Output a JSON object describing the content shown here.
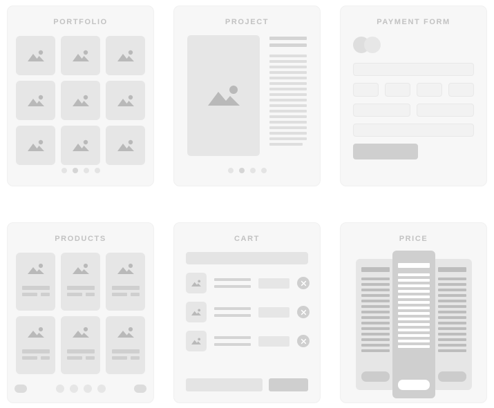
{
  "page": {
    "background_color": "#ffffff",
    "card_background": "#f7f7f7",
    "title_color": "#c2c2c2",
    "placeholder_light": "#e6e6e6",
    "placeholder_mid": "#dedede",
    "placeholder_dark": "#cfcfcf",
    "accent_white": "#ffffff"
  },
  "cards": [
    {
      "id": "portfolio",
      "title": "PORTFOLIO",
      "layout": "image-grid",
      "tiles": 9,
      "tile_icon": "image-placeholder-icon",
      "pagination": {
        "dots": 4,
        "active_index": 1
      }
    },
    {
      "id": "project",
      "title": "PROJECT",
      "layout": "image-plus-text",
      "hero_icon": "image-placeholder-icon",
      "heading_lines": 2,
      "body_lines": 17,
      "pagination": {
        "dots": 4,
        "active_index": 1
      }
    },
    {
      "id": "payment-form",
      "title": "PAYMENT FORM",
      "layout": "form",
      "card_logo": "credit-card-circles-icon",
      "fields": [
        {
          "name": "card-number-field",
          "span": "full"
        },
        {
          "name": "card-digits-group-1",
          "span": "quarter"
        },
        {
          "name": "card-digits-group-2",
          "span": "quarter"
        },
        {
          "name": "card-digits-group-3",
          "span": "quarter"
        },
        {
          "name": "card-digits-group-4",
          "span": "quarter"
        },
        {
          "name": "expiry-field",
          "span": "half"
        },
        {
          "name": "cvv-field",
          "span": "half"
        },
        {
          "name": "cardholder-name-field",
          "span": "full"
        }
      ],
      "submit_button": "submit-payment-button"
    },
    {
      "id": "products",
      "title": "PRODUCTS",
      "layout": "product-grid",
      "tiles": 6,
      "tile_icon": "image-placeholder-icon",
      "pagination": {
        "dots": 4,
        "prev": "prev-page-button",
        "next": "next-page-button"
      }
    },
    {
      "id": "cart",
      "title": "CART",
      "layout": "list",
      "header_bar": "cart-header-bar",
      "rows": 3,
      "row_icon": "image-placeholder-icon",
      "row_remove_icon": "close-circle-icon",
      "footer": {
        "total_bar": "cart-total-bar",
        "checkout_button": "checkout-button"
      }
    },
    {
      "id": "price",
      "title": "PRICE",
      "layout": "pricing-columns",
      "columns": [
        {
          "name": "plan-basic",
          "featured": false,
          "feature_lines": 14,
          "cta": "choose-plan-button"
        },
        {
          "name": "plan-pro",
          "featured": true,
          "feature_lines": 14,
          "cta": "choose-plan-button"
        },
        {
          "name": "plan-enterprise",
          "featured": false,
          "feature_lines": 14,
          "cta": "choose-plan-button"
        }
      ]
    }
  ]
}
